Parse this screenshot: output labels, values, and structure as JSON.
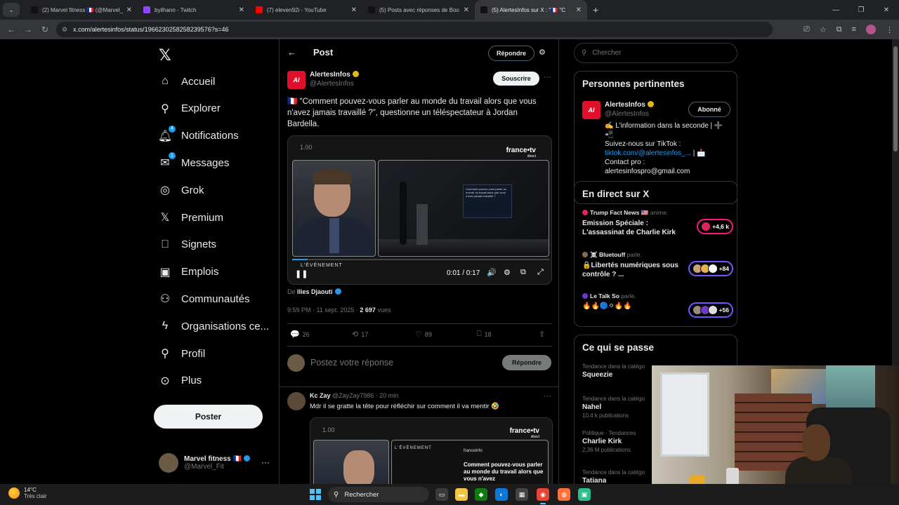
{
  "browser": {
    "tabs": [
      {
        "title": "(2) Marvel fitness 🇫🇷 (@Marvel_",
        "color": "#111111",
        "icon": "x-logo-icon"
      },
      {
        "title": "byilhann - Twitch",
        "color": "#9146ff",
        "icon": "twitch-icon"
      },
      {
        "title": "(7) eleven92i - YouTube",
        "color": "#ff0000",
        "icon": "youtube-icon"
      },
      {
        "title": "(5) Posts avec réponses de Boo",
        "color": "#111111",
        "icon": "x-logo-icon"
      },
      {
        "title": "(5) AlertesInfos sur X : \"🇫🇷 \"C",
        "color": "#111111",
        "icon": "x-logo-icon"
      }
    ],
    "url": "x.com/alertesinfos/status/1966230258258239576?s=46"
  },
  "nav": {
    "items": [
      {
        "label": "Accueil",
        "icon": "home-icon"
      },
      {
        "label": "Explorer",
        "icon": "search-icon"
      },
      {
        "label": "Notifications",
        "icon": "bell-icon",
        "badge": "4"
      },
      {
        "label": "Messages",
        "icon": "envelope-icon",
        "badge": "1"
      },
      {
        "label": "Grok",
        "icon": "grok-icon"
      },
      {
        "label": "Premium",
        "icon": "x-logo-icon"
      },
      {
        "label": "Signets",
        "icon": "bookmark-icon"
      },
      {
        "label": "Emplois",
        "icon": "briefcase-icon"
      },
      {
        "label": "Communautés",
        "icon": "people-icon"
      },
      {
        "label": "Organisations ce...",
        "icon": "lightning-icon"
      },
      {
        "label": "Profil",
        "icon": "person-icon"
      },
      {
        "label": "Plus",
        "icon": "more-circle-icon"
      }
    ],
    "post_button": "Poster",
    "account": {
      "name": "Marvel fitness 🇫🇷",
      "handle": "@Marvel_Fit"
    }
  },
  "main": {
    "header_title": "Post",
    "reply_button": "Répondre",
    "tweet": {
      "author_name": "AlertesInfos",
      "avatar_text": "AI",
      "author_handle": "@AlertesInfos",
      "subscribe_label": "Souscrire",
      "text": "🇫🇷 \"Comment pouvez-vous parler au monde du travail alors que vous n'avez jamais travaillé ?\", questionne un téléspectateur à Jordan Bardella.",
      "video": {
        "corner_number": "1.00",
        "brand": "france•tv",
        "brand_sub": "direct",
        "event_label": "L'ÉVÉNEMENT",
        "screen_text": "Comment pouvez-vous parler au monde du travail alors que vous n'avez jamais travaillé ?",
        "time": "0:01 / 0:17",
        "progress": 0.06
      },
      "byline_prefix": "De",
      "byline_name": "Ilies Djaouti",
      "timestamp": "9:59 PM · 11 sept. 2025 ·",
      "views_count": "2 697",
      "views_label": "vues",
      "stats": {
        "replies": "26",
        "reposts": "17",
        "likes": "89",
        "bookmarks": "18"
      }
    },
    "compose": {
      "placeholder": "Postez votre réponse",
      "button": "Répondre"
    },
    "reply": {
      "name": "Kc Zay",
      "handle": "@ZayZay7986 · 20 min",
      "text": "Mdr il se gratte la tête pour réfléchir sur comment il va mentir 🤣",
      "video": {
        "corner_number": "1.00",
        "brand": "france•tv",
        "brand_sub": "direct",
        "event_label": "L'ÉVÉNEMENT",
        "channel_label": "franceinfo:",
        "caption": "Comment pouvez-vous parler au monde du travail alors que vous n'avez"
      }
    }
  },
  "right": {
    "search_placeholder": "Chercher",
    "relevant": {
      "title": "Personnes pertinentes",
      "name": "AlertesInfos",
      "avatar_text": "AI",
      "handle": "@AlertesInfos",
      "follow_label": "Abonné",
      "bio_line1": "✍️ L'information dans la seconde | ➕📲",
      "bio_line2": "Suivez-nous sur TikTok :",
      "bio_link": "tiktok.com/@alertesinfos_...",
      "bio_line3": "| 📩",
      "bio_line4": "Contact pro :",
      "bio_line5": "alertesinfospro@gmail.com"
    },
    "live": {
      "title": "En direct sur X",
      "items": [
        {
          "host": "Trump Fact News 🇺🇸",
          "status": "anime.",
          "title": "Emission Spéciale : L'assassinat de Charlie Kirk",
          "count": "+4,6 k",
          "dot_color": "#e0245e",
          "pill": "red",
          "avatars": [
            "#e0245e"
          ]
        },
        {
          "host": "☠️ Bluetouff",
          "status": "parle.",
          "title": "🔒Libertés numériques sous contrôle ? ...",
          "count": "+84",
          "dot_color": "#8a6a4a",
          "pill": "purple",
          "avatars": [
            "#c9a27a",
            "#e8b04a",
            "#ffffff"
          ]
        },
        {
          "host": "Le Talk So",
          "status": "parle.",
          "title": "🔥🔥🔵⚪🔥🔥",
          "count": "+56",
          "dot_color": "#6a3ac8",
          "pill": "purple",
          "avatars": [
            "#9a8a7a",
            "#6a3ac8",
            "#ddd"
          ]
        }
      ]
    },
    "trends": {
      "title": "Ce qui se passe",
      "items": [
        {
          "category": "Tendance dans la catégo",
          "name": "Squeezie",
          "count": ""
        },
        {
          "category": "Tendance dans la catégo",
          "name": "Nahel",
          "count": "10,4 k publications"
        },
        {
          "category": "Politique · Tendances",
          "name": "Charlie Kirk",
          "count": "2,36 M publications"
        },
        {
          "category": "Tendance dans la catégo",
          "name": "Tatiana",
          "count": ""
        }
      ]
    }
  },
  "taskbar": {
    "temperature": "14°C",
    "weather": "Très clair",
    "search_label": "Rechercher"
  }
}
